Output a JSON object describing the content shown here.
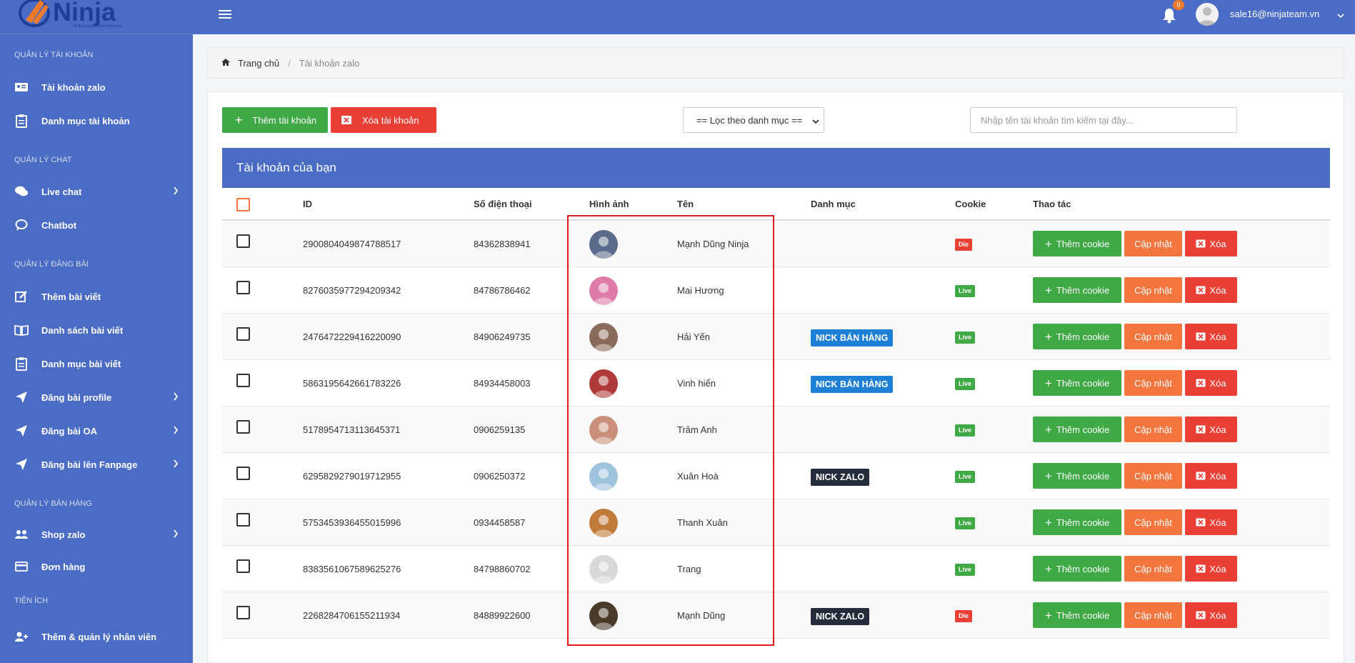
{
  "logo": {
    "text": "Ninja",
    "subtitle": "Hệ thống phần mềm Marketing"
  },
  "topbar": {
    "notification_count": "0",
    "user_email": "sale16@ninjateam.vn"
  },
  "sidebar": {
    "sections": [
      {
        "title": "QUẢN LÝ TÀI KHOẢN",
        "items": [
          {
            "label": "Tài khoản zalo",
            "icon": "id-card-icon"
          },
          {
            "label": "Danh mục tài khoản",
            "icon": "clipboard-icon"
          }
        ]
      },
      {
        "title": "QUẢN LÝ CHAT",
        "items": [
          {
            "label": "Live chat",
            "icon": "chat-icon"
          },
          {
            "label": "Chatbot",
            "icon": "speech-bubble-icon"
          }
        ]
      },
      {
        "title": "QUẢN LÝ ĐĂNG BÀI",
        "items": [
          {
            "label": "Thêm bài viết",
            "icon": "edit-icon"
          },
          {
            "label": "Danh sách bài viết",
            "icon": "book-icon"
          },
          {
            "label": "Danh mục bài viết",
            "icon": "clipboard-icon"
          },
          {
            "label": "Đăng bài profile",
            "icon": "send-icon"
          },
          {
            "label": "Đăng bài OA",
            "icon": "send-icon"
          },
          {
            "label": "Đăng bài lên Fanpage",
            "icon": "send-icon"
          }
        ]
      },
      {
        "title": "QUẢN LÝ BÁN HÀNG",
        "items": [
          {
            "label": "Shop zalo",
            "icon": "users-icon"
          },
          {
            "label": "Đơn hàng",
            "icon": "credit-card-icon"
          }
        ]
      },
      {
        "title": "TIỆN ÍCH",
        "items": [
          {
            "label": "Thêm & quản lý nhân viên",
            "icon": "user-plus-icon"
          }
        ]
      }
    ]
  },
  "breadcrumb": {
    "home": "Trang chủ",
    "separator": "/",
    "current": "Tài khoản zalo"
  },
  "toolbar": {
    "add_label": "Thêm tài khoản",
    "delete_label": "Xóa tài khoản",
    "filter_label": "== Lọc theo danh mục ==",
    "search_placeholder": "Nhập tên tài khoản tìm kiếm tại đây..."
  },
  "table": {
    "title": "Tài khoản của bạn",
    "columns": {
      "id": "ID",
      "phone": "Số điện thoại",
      "image": "Hình ảnh",
      "name": "Tên",
      "category": "Danh mục",
      "cookie": "Cookie",
      "actions": "Thao tác"
    },
    "action_labels": {
      "add_cookie": "Thêm cookie",
      "update": "Cập nhật",
      "delete": "Xóa"
    },
    "rows": [
      {
        "id": "2900804049874788517",
        "phone": "84362838941",
        "name": "Mạnh Dũng Ninja",
        "category": "",
        "category_style": "",
        "cookie": "Die",
        "avatar_color": "#5a6a8a"
      },
      {
        "id": "8276035977294209342",
        "phone": "84786786462",
        "name": "Mai Hương",
        "category": "",
        "category_style": "",
        "cookie": "Live",
        "avatar_color": "#e07aa8"
      },
      {
        "id": "2476472229416220090",
        "phone": "84906249735",
        "name": "Hải Yến",
        "category": "NICK BÁN HÀNG",
        "category_style": "blue",
        "cookie": "Live",
        "avatar_color": "#8a6a5a"
      },
      {
        "id": "5863195642661783226",
        "phone": "84934458003",
        "name": "Vinh hiển",
        "category": "NICK BÁN HÀNG",
        "category_style": "blue",
        "cookie": "Live",
        "avatar_color": "#b03a3a"
      },
      {
        "id": "5178954713113645371",
        "phone": "0906259135",
        "name": "Trâm Anh",
        "category": "",
        "category_style": "",
        "cookie": "Live",
        "avatar_color": "#c98f7a"
      },
      {
        "id": "6295829279019712955",
        "phone": "0906250372",
        "name": "Xuân Hoà",
        "category": "NICK ZALO",
        "category_style": "dark",
        "cookie": "Live",
        "avatar_color": "#9ec3dc"
      },
      {
        "id": "5753453936455015996",
        "phone": "0934458587",
        "name": "Thanh Xuân",
        "category": "",
        "category_style": "",
        "cookie": "Live",
        "avatar_color": "#c07a3a"
      },
      {
        "id": "8383561067589625276",
        "phone": "84798860702",
        "name": "Trang",
        "category": "",
        "category_style": "",
        "cookie": "Live",
        "avatar_color": "#d8d8d8"
      },
      {
        "id": "2268284706155211934",
        "phone": "84889922600",
        "name": "Mạnh Dũng",
        "category": "NICK ZALO",
        "category_style": "dark",
        "cookie": "Die",
        "avatar_color": "#4a3a2a"
      }
    ]
  },
  "colors": {
    "brand": "#4a6cc4",
    "green": "#3fa945",
    "red": "#ea3f35",
    "orange": "#f4753d",
    "highlight": "#e01b1b"
  }
}
